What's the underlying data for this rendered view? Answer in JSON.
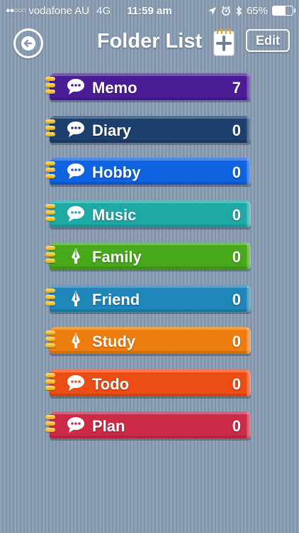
{
  "status_bar": {
    "signal_dots": "●●○○○",
    "carrier": "vodafone AU",
    "network": "4G",
    "time": "11:59 am",
    "battery_percent": "65%",
    "battery_level": 0.65
  },
  "nav": {
    "title": "Folder List",
    "back_icon": "back-arrow-icon",
    "add_icon": "add-note-icon",
    "edit_label": "Edit"
  },
  "folders": [
    {
      "label": "Memo",
      "count": "7",
      "icon": "speech-bubble-icon",
      "color": "#4a1d96"
    },
    {
      "label": "Diary",
      "count": "0",
      "icon": "speech-bubble-icon",
      "color": "#1d3f6e"
    },
    {
      "label": "Hobby",
      "count": "0",
      "icon": "speech-bubble-icon",
      "color": "#0f63e0"
    },
    {
      "label": "Music",
      "count": "0",
      "icon": "speech-bubble-icon",
      "color": "#1ea9a6"
    },
    {
      "label": "Family",
      "count": "0",
      "icon": "pen-nib-icon",
      "color": "#47a81a"
    },
    {
      "label": "Friend",
      "count": "0",
      "icon": "pen-nib-icon",
      "color": "#1f86b8"
    },
    {
      "label": "Study",
      "count": "0",
      "icon": "pen-nib-icon",
      "color": "#ee7d0f"
    },
    {
      "label": "Todo",
      "count": "0",
      "icon": "speech-bubble-icon",
      "color": "#ec4d14"
    },
    {
      "label": "Plan",
      "count": "0",
      "icon": "speech-bubble-icon",
      "color": "#cc2a47"
    }
  ]
}
